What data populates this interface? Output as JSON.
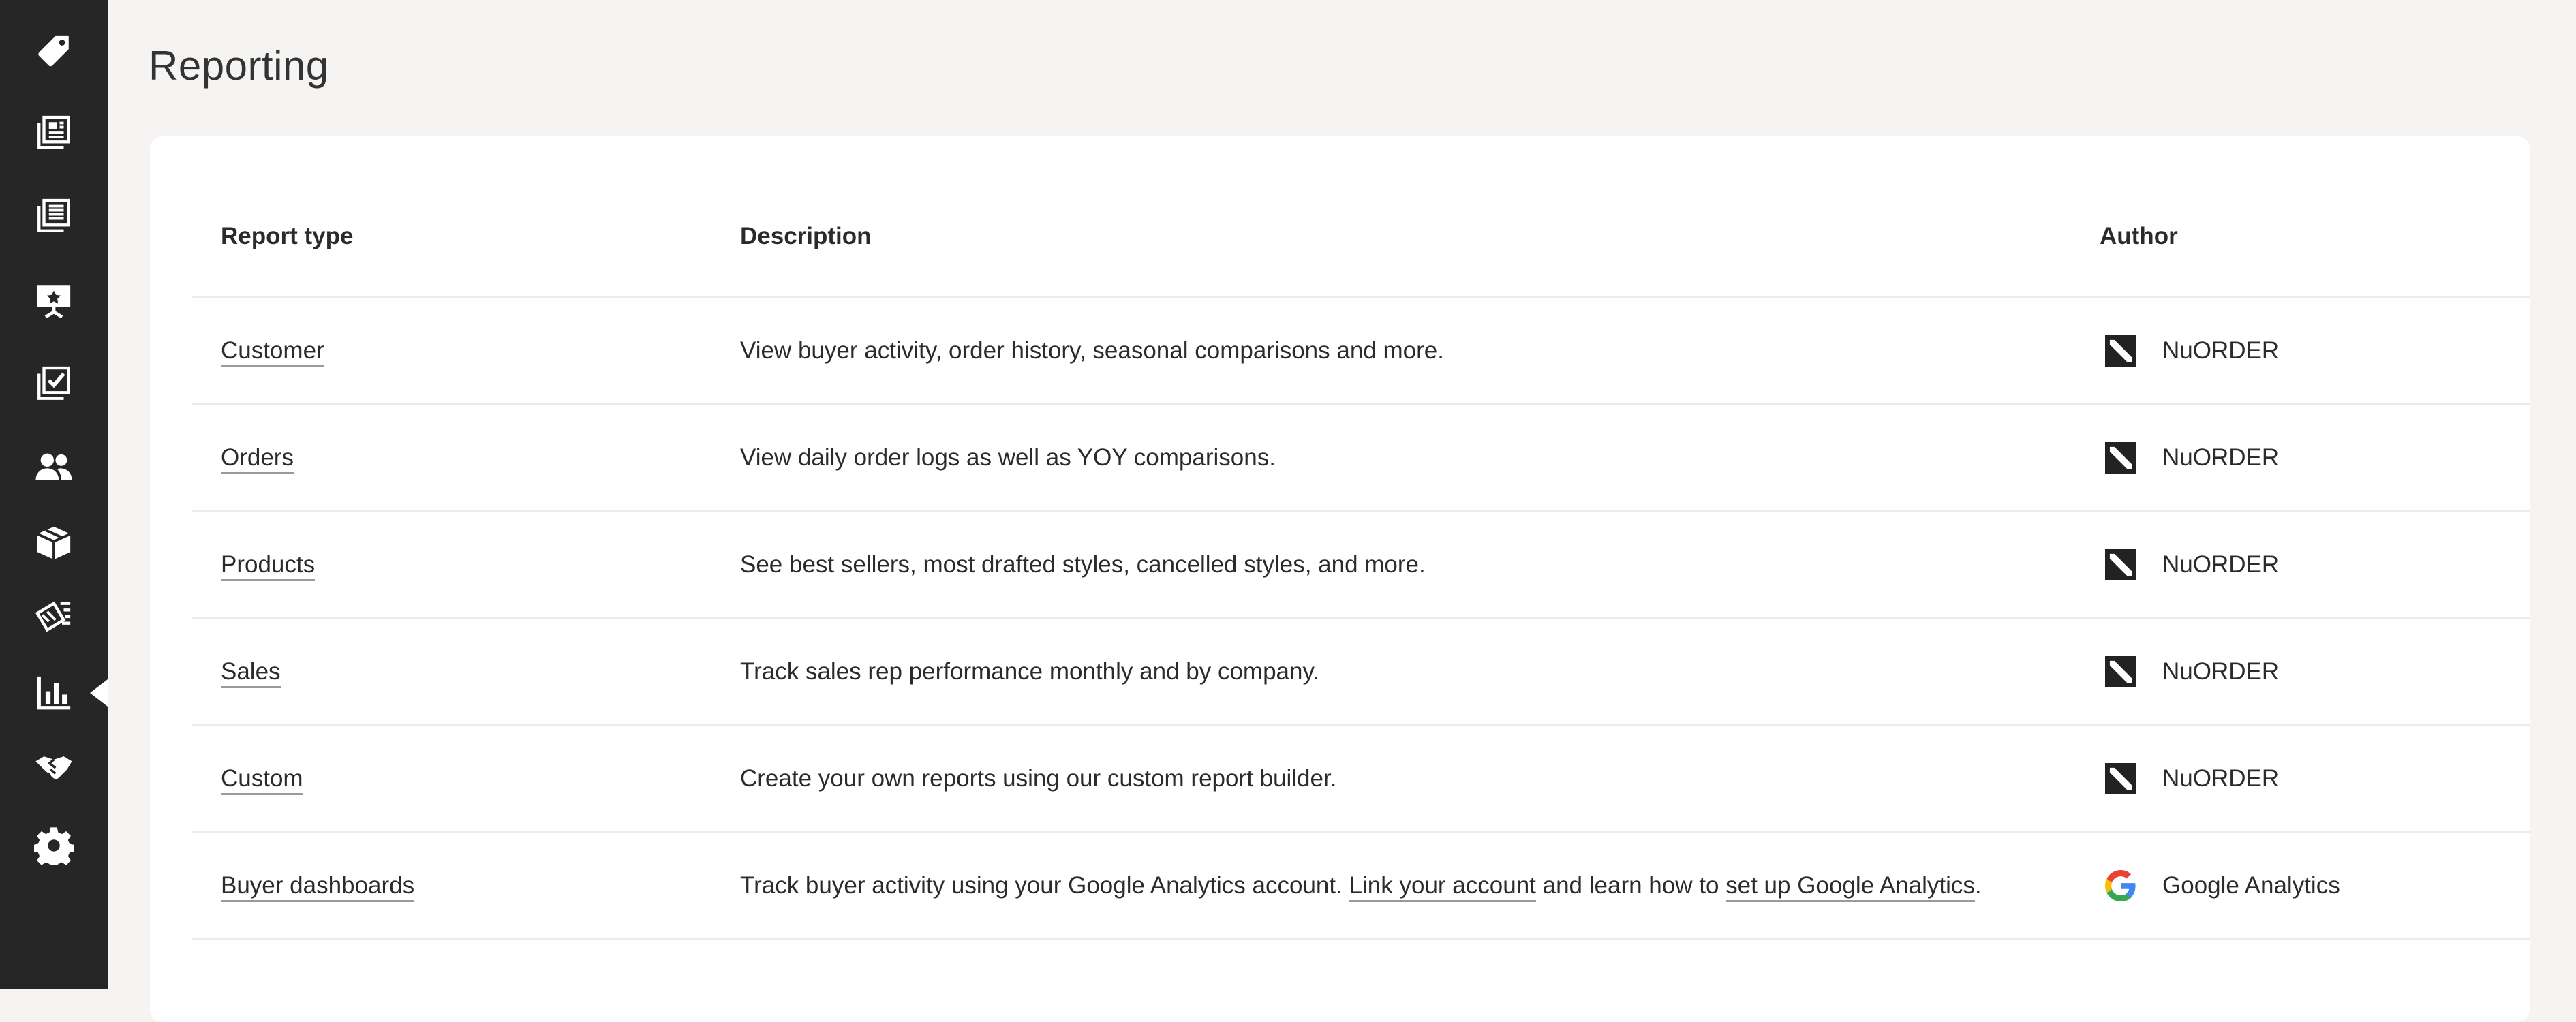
{
  "sidebar": {
    "items": [
      {
        "icon": "tag-icon",
        "active": false
      },
      {
        "icon": "catalog-icon",
        "active": false
      },
      {
        "icon": "linesheet-icon",
        "active": false
      },
      {
        "icon": "presentation-icon",
        "active": false
      },
      {
        "icon": "checklist-icon",
        "active": false
      },
      {
        "icon": "users-icon",
        "active": false
      },
      {
        "icon": "box-icon",
        "active": false
      },
      {
        "icon": "marketing-icon",
        "active": false
      },
      {
        "icon": "bar-chart-icon",
        "active": true
      },
      {
        "icon": "handshake-icon",
        "active": false
      },
      {
        "icon": "gear-icon",
        "active": false
      }
    ]
  },
  "page": {
    "title": "Reporting"
  },
  "table": {
    "headers": {
      "type": "Report type",
      "description": "Description",
      "author": "Author"
    },
    "rows": [
      {
        "type": "Customer",
        "description": "View buyer activity, order history, seasonal comparisons and more.",
        "author": "NuORDER",
        "author_icon": "nuorder-logo-icon"
      },
      {
        "type": "Orders",
        "description": "View daily order logs as well as YOY comparisons.",
        "author": "NuORDER",
        "author_icon": "nuorder-logo-icon"
      },
      {
        "type": "Products",
        "description": "See best sellers, most drafted styles, cancelled styles, and more.",
        "author": "NuORDER",
        "author_icon": "nuorder-logo-icon"
      },
      {
        "type": "Sales",
        "description": "Track sales rep performance monthly and by company.",
        "author": "NuORDER",
        "author_icon": "nuorder-logo-icon"
      },
      {
        "type": "Custom",
        "description": "Create your own reports using our custom report builder.",
        "author": "NuORDER",
        "author_icon": "nuorder-logo-icon"
      },
      {
        "type": "Buyer dashboards",
        "description_prefix": "Track buyer activity using your Google Analytics account. ",
        "description_link1": "Link your account",
        "description_middle": " and learn how to ",
        "description_link2": "set up Google Analytics",
        "description_suffix": ".",
        "author": "Google Analytics",
        "author_icon": "google-logo-icon"
      }
    ]
  }
}
